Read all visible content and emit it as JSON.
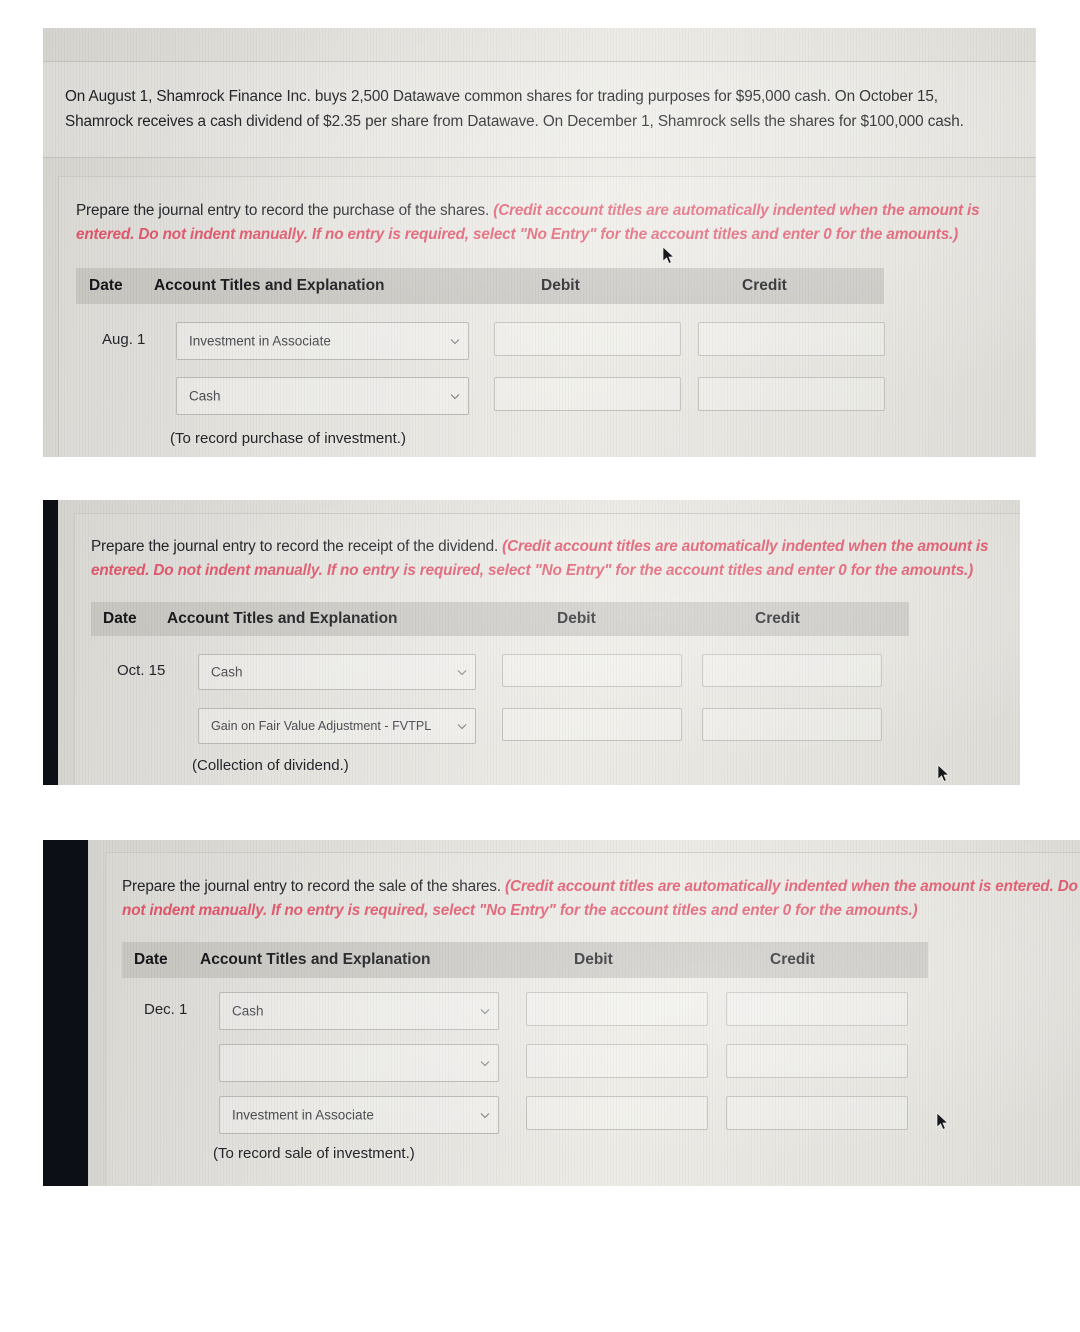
{
  "problem": {
    "text": "On August 1, Shamrock Finance Inc. buys 2,500 Datawave common shares for trading purposes for $95,000 cash. On October 15, Shamrock receives a cash dividend of $2.35 per share from Datawave. On December 1, Shamrock sells the shares for $100,000 cash."
  },
  "common": {
    "hint": "(Credit account titles are automatically indented when the amount is entered. Do not indent manually. If no entry is required, select \"No Entry\" for the account titles and enter 0 for the amounts.)",
    "columns": {
      "date": "Date",
      "account": "Account Titles and Explanation",
      "debit": "Debit",
      "credit": "Credit"
    },
    "chevron_icon": "chevron-down-icon",
    "cursor_icon": "mouse-pointer-icon",
    "accent_hint_color": "#e0566b",
    "header_bg_color": "#c9c7c2"
  },
  "panels": [
    {
      "id": "purchase",
      "prompt": "Prepare the journal entry to record the purchase of the shares.",
      "hint": "(Credit account titles are automatically indented when the amount is entered. Do not indent manually. If no entry is required, select \"No Entry\" for the account titles and enter 0 for the amounts.)",
      "date": "Aug. 1",
      "rows": [
        {
          "account": "Investment in Associate",
          "debit": "",
          "credit": ""
        },
        {
          "account": "Cash",
          "debit": "",
          "credit": ""
        }
      ],
      "memo": "(To record purchase of investment.)"
    },
    {
      "id": "dividend",
      "prompt": "Prepare the journal entry to record the receipt of the dividend.",
      "hint": "(Credit account titles are automatically indented when the amount is entered. Do not indent manually. If no entry is required, select \"No Entry\" for the account titles and enter 0 for the amounts.)",
      "date": "Oct. 15",
      "rows": [
        {
          "account": "Cash",
          "debit": "",
          "credit": ""
        },
        {
          "account": "Gain on Fair Value Adjustment - FVTPL",
          "debit": "",
          "credit": ""
        }
      ],
      "memo": "(Collection of dividend.)"
    },
    {
      "id": "sale",
      "prompt": "Prepare the journal entry to record the sale of the shares.",
      "hint": "(Credit account titles are automatically indented when the amount is entered. Do not indent manually. If no entry is required, select \"No Entry\" for the account titles and enter 0 for the amounts.)",
      "date": "Dec. 1",
      "rows": [
        {
          "account": "Cash",
          "debit": "",
          "credit": ""
        },
        {
          "account": "",
          "debit": "",
          "credit": ""
        },
        {
          "account": "Investment in Associate",
          "debit": "",
          "credit": ""
        }
      ],
      "memo": "(To record sale of investment.)"
    }
  ]
}
